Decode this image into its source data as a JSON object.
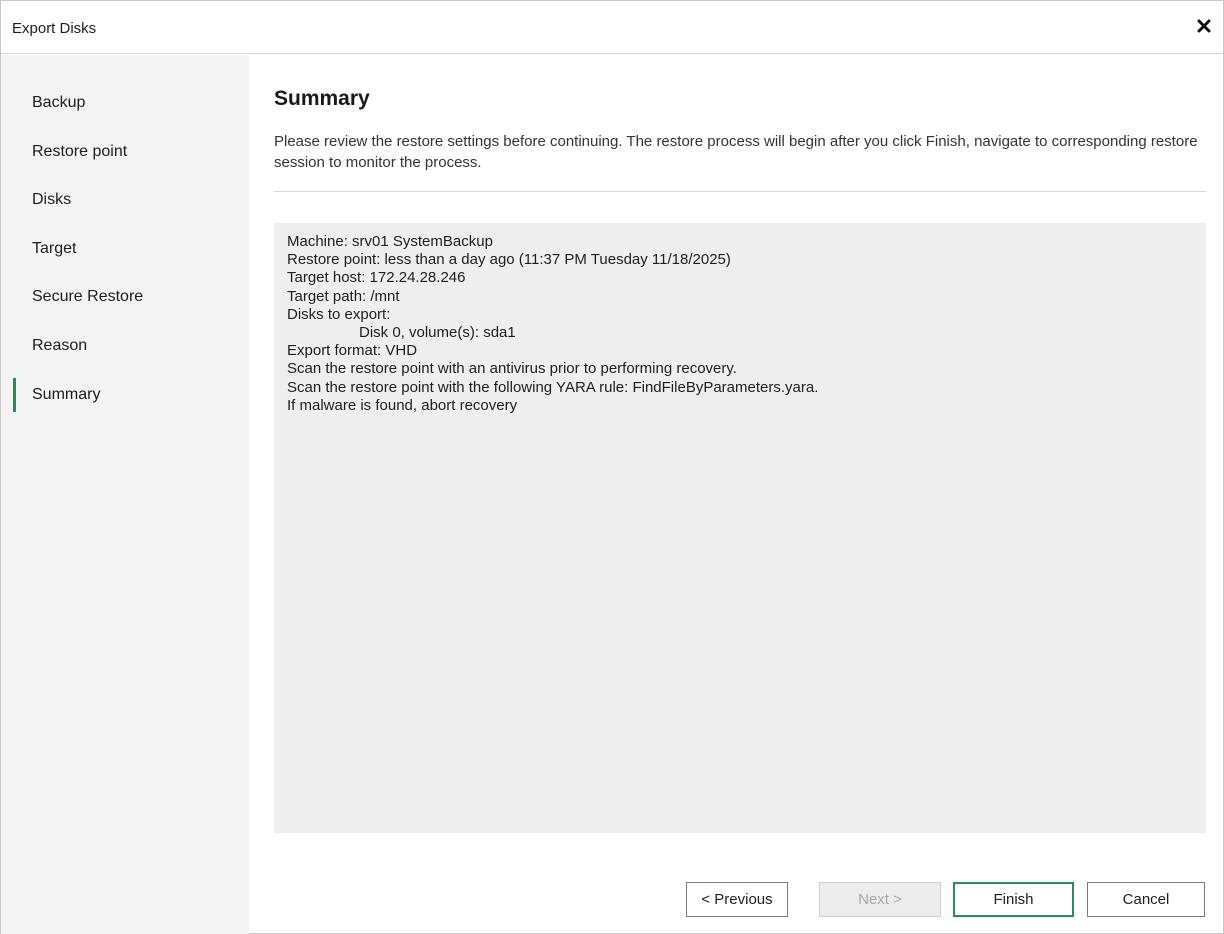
{
  "window": {
    "title": "Export Disks"
  },
  "icons": {
    "close": "close-icon"
  },
  "sidebar": {
    "steps": [
      {
        "label": "Backup",
        "active": false
      },
      {
        "label": "Restore point",
        "active": false
      },
      {
        "label": "Disks",
        "active": false
      },
      {
        "label": "Target",
        "active": false
      },
      {
        "label": "Secure Restore",
        "active": false
      },
      {
        "label": "Reason",
        "active": false
      },
      {
        "label": "Summary",
        "active": true
      }
    ]
  },
  "main": {
    "title": "Summary",
    "description": "Please review the restore settings before continuing. The restore process will begin after you click Finish, navigate to corresponding restore session to monitor the process.",
    "summary_lines": [
      "Machine: srv01 SystemBackup",
      "Restore point: less than a day ago (11:37 PM Tuesday 11/18/2025)",
      "Target host: 172.24.28.246",
      "Target path: /mnt",
      "Disks to export:",
      "Disk 0, volume(s): sda1",
      "Export format: VHD",
      "Scan the restore point with an antivirus prior to performing recovery.",
      "Scan the restore point with the following YARA rule: FindFileByParameters.yara.",
      "If malware is found, abort recovery"
    ]
  },
  "buttons": {
    "previous": "< Previous",
    "next": "Next >",
    "finish": "Finish",
    "cancel": "Cancel"
  },
  "colors": {
    "accent": "#2e8b57",
    "sidebar_bg": "#f3f3f3",
    "summary_bg": "#eeeeee"
  }
}
